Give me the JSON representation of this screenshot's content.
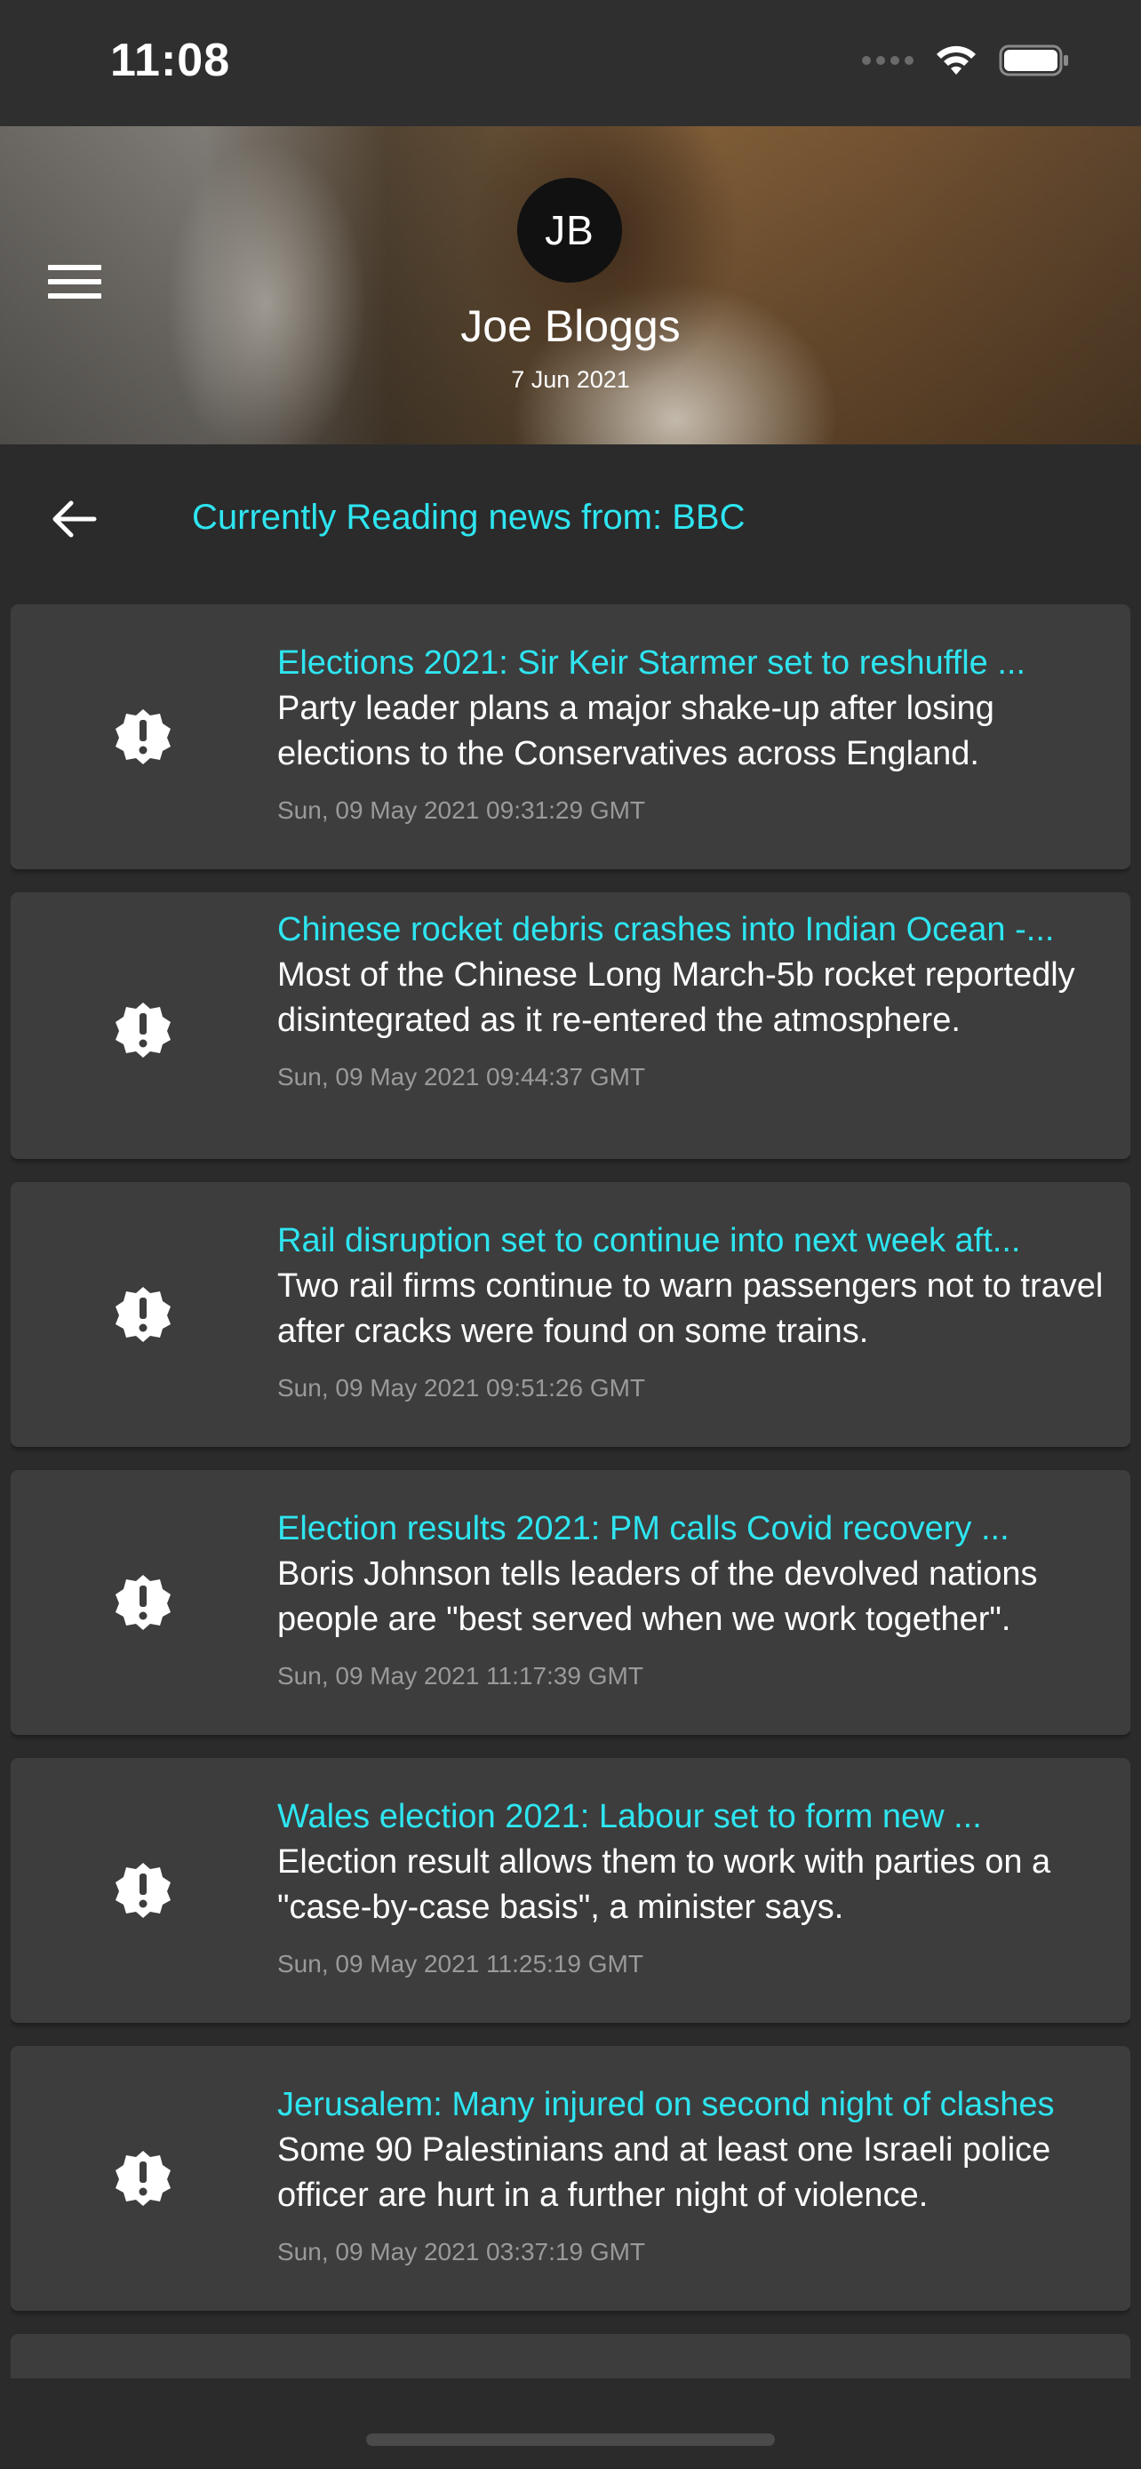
{
  "status_bar": {
    "time": "11:08"
  },
  "header": {
    "avatar_initials": "JB",
    "user_name": "Joe Bloggs",
    "date": "7 Jun 2021"
  },
  "reading_bar": {
    "label": "Currently Reading news from: BBC"
  },
  "colors": {
    "accent": "#2ee5f0",
    "background": "#2b2b2b",
    "card": "#3d3d3d",
    "muted_text": "#9a9a9a"
  },
  "icons": {
    "menu": "menu-icon",
    "back": "back-arrow-icon",
    "alert": "alert-badge-icon"
  },
  "articles": [
    {
      "title": "Elections 2021: Sir Keir Starmer set to reshuffle ...",
      "description": "Party leader plans a major shake-up after losing elections to the Conservatives across England.",
      "date": "Sun, 09 May 2021 09:31:29 GMT"
    },
    {
      "title": "Chinese rocket debris crashes into Indian Ocean -...",
      "description": "Most of the Chinese Long March-5b rocket reportedly disintegrated as it re-entered the atmosphere.",
      "date": "Sun, 09 May 2021 09:44:37 GMT"
    },
    {
      "title": "Rail disruption set to continue into next week aft...",
      "description": "Two rail firms continue to warn passengers not to travel after cracks were found on some trains.",
      "date": "Sun, 09 May 2021 09:51:26 GMT"
    },
    {
      "title": "Election results 2021: PM calls Covid recovery ...",
      "description": "Boris Johnson tells leaders of the devolved nations people are \"best served when we work together\".",
      "date": "Sun, 09 May 2021 11:17:39 GMT"
    },
    {
      "title": "Wales election 2021: Labour set to form new ...",
      "description": "Election result allows them to work with parties on a \"case-by-case basis\", a minister says.",
      "date": "Sun, 09 May 2021 11:25:19 GMT"
    },
    {
      "title": "Jerusalem: Many injured on second night of clashes",
      "description": "Some 90 Palestinians and at least one Israeli police officer are hurt in a further night of violence.",
      "date": "Sun, 09 May 2021 03:37:19 GMT"
    }
  ]
}
